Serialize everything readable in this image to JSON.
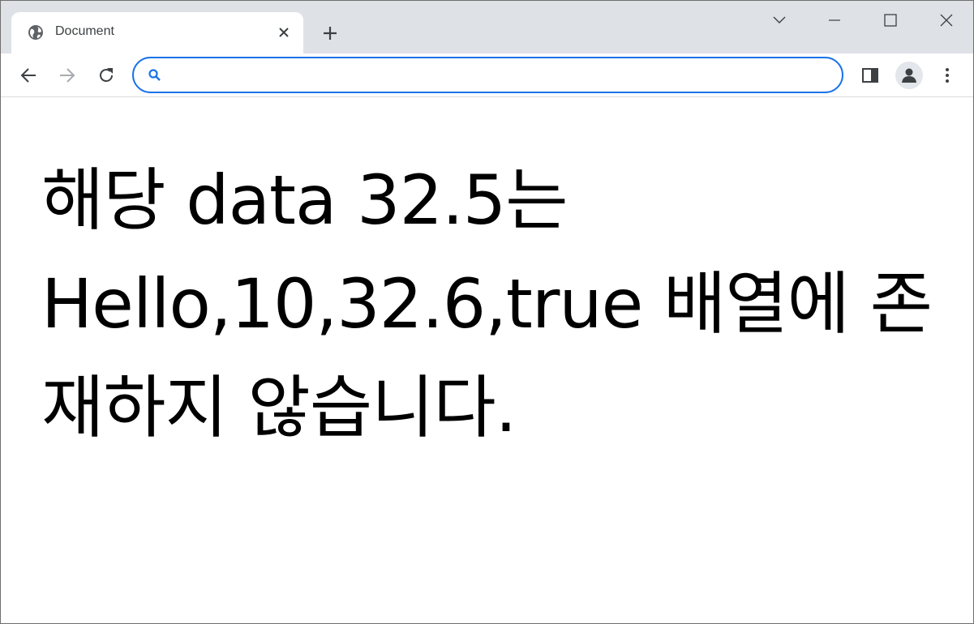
{
  "browser": {
    "tab": {
      "title": "Document",
      "favicon": "globe-icon"
    },
    "window_controls": [
      "tab-search-icon",
      "minimize-icon",
      "maximize-icon",
      "close-icon"
    ],
    "toolbar": {
      "back": "back-arrow-icon",
      "forward": "forward-arrow-icon",
      "reload": "reload-icon",
      "omnibox": {
        "value": "",
        "icon": "search-icon"
      },
      "side_panel": "side-panel-icon",
      "profile": "profile-icon",
      "menu": "kebab-menu-icon"
    },
    "colors": {
      "tabstrip": "#dee1e6",
      "focus_ring": "#1a73e8",
      "search_icon": "#1a73e8"
    }
  },
  "page": {
    "message": "해당 data 32.5는 Hello,10,32.6,true 배열에 존재하지 않습니다."
  }
}
